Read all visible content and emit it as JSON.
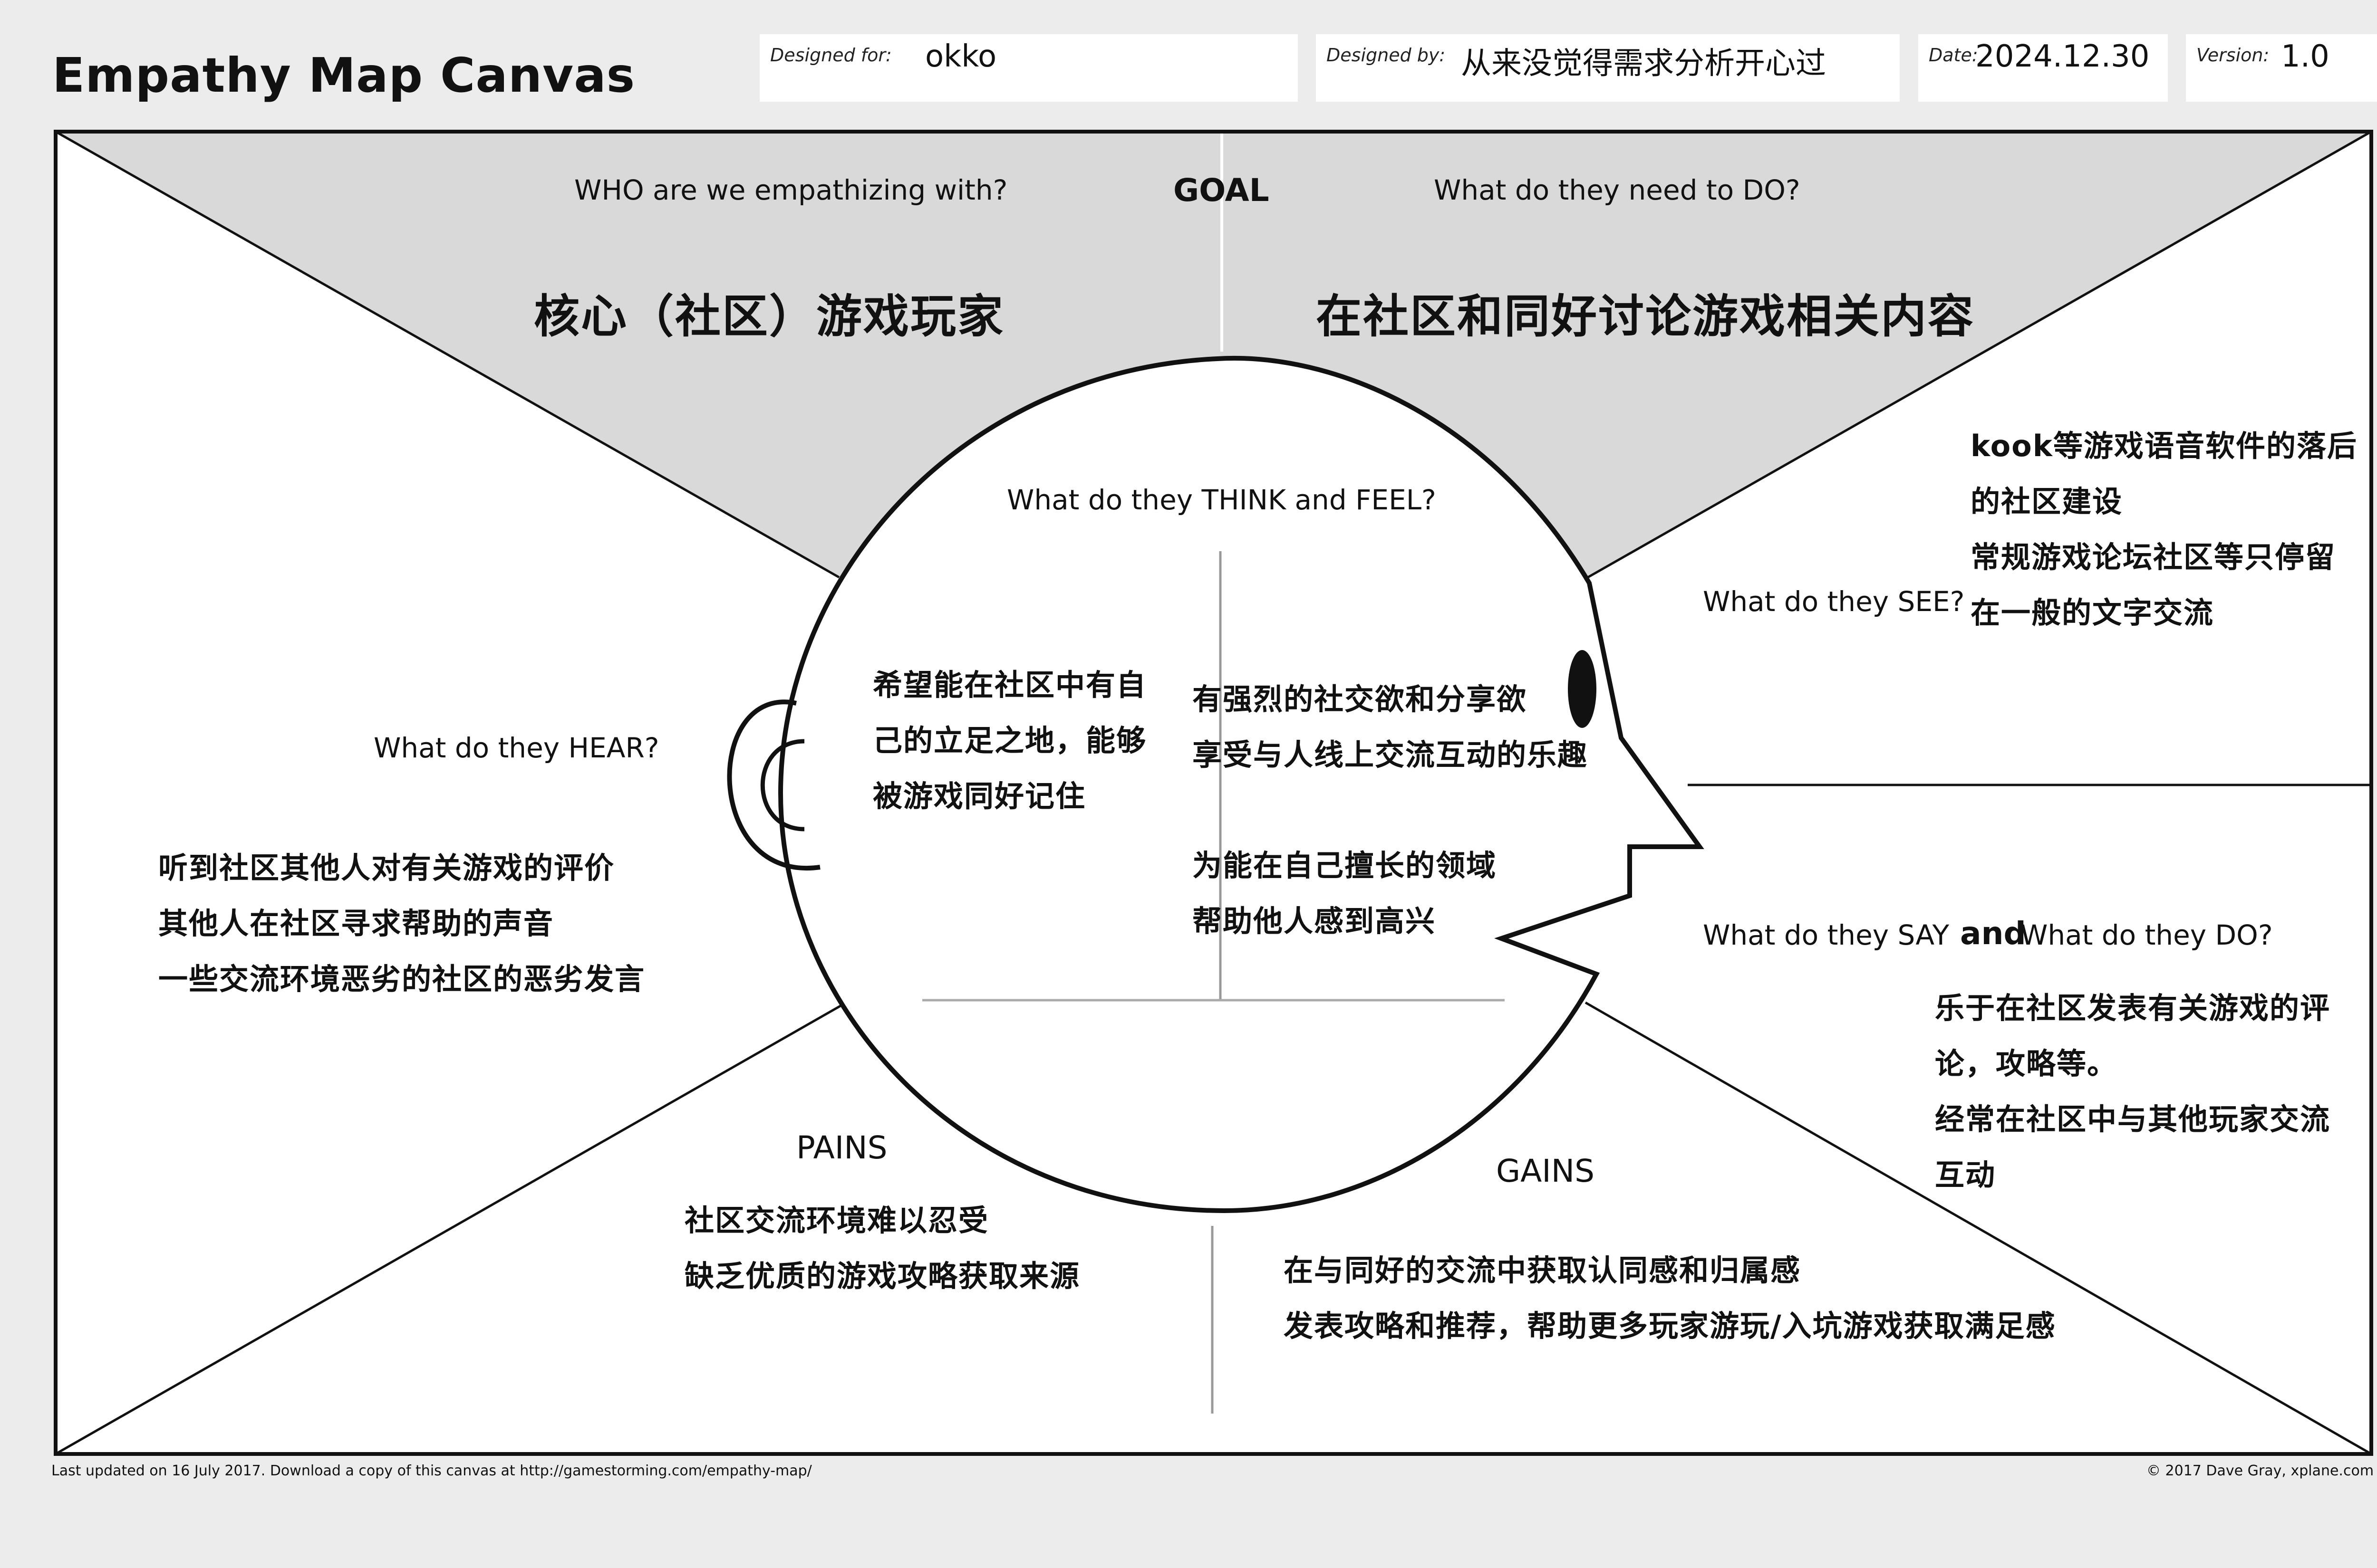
{
  "header": {
    "title": "Empathy Map Canvas",
    "designed_for_label": "Designed for:",
    "designed_for_value": "okko",
    "designed_by_label": "Designed by:",
    "designed_by_value": "从来没觉得需求分析开心过",
    "date_label": "Date:",
    "date_value": "2024.12.30",
    "version_label": "Version:",
    "version_value": "1.0"
  },
  "goal": {
    "label": "GOAL",
    "who_question": "WHO are we empathizing with?",
    "who_answer": "核心（社区）游戏玩家",
    "do_question": "What do they need to DO?",
    "do_answer": "在社区和同好讨论游戏相关内容"
  },
  "think_feel": {
    "question": "What do they THINK and FEEL?",
    "left_lines": [
      "希望能在社区中有自",
      "己的立足之地，能够",
      "被游戏同好记住"
    ],
    "right_lines_a": [
      "有强烈的社交欲和分享欲",
      "享受与人线上交流互动的乐趣"
    ],
    "right_lines_b": [
      "为能在自己擅长的领域",
      "帮助他人感到高兴"
    ]
  },
  "see": {
    "question": "What do they SEE?",
    "lines": [
      "kook等游戏语音软件的落后",
      "的社区建设",
      "常规游戏论坛社区等只停留",
      "在一般的文字交流"
    ]
  },
  "hear": {
    "question": "What do they HEAR?",
    "lines": [
      "听到社区其他人对有关游戏的评价",
      "其他人在社区寻求帮助的声音",
      "一些交流环境恶劣的社区的恶劣发言"
    ]
  },
  "say_do": {
    "question_say": "What do they SAY",
    "question_and": "and",
    "question_do": "What do they DO?",
    "lines": [
      "乐于在社区发表有关游戏的评",
      "论，攻略等。",
      "经常在社区中与其他玩家交流",
      "互动"
    ]
  },
  "pains": {
    "label": "PAINS",
    "lines": [
      "社区交流环境难以忍受",
      "缺乏优质的游戏攻略获取来源"
    ]
  },
  "gains": {
    "label": "GAINS",
    "lines": [
      "在与同好的交流中获取认同感和归属感",
      "发表攻略和推荐，帮助更多玩家游玩/入坑游戏获取满足感"
    ]
  },
  "footer": {
    "left": "Last updated on 16 July 2017. Download a copy of this canvas at http://gamestorming.com/empathy-map/",
    "right": "© 2017 Dave Gray, xplane.com"
  },
  "colors": {
    "page_background": "#ececec",
    "goal_area": "#d9d9d9",
    "canvas": "#ffffff",
    "stroke": "#111111"
  }
}
